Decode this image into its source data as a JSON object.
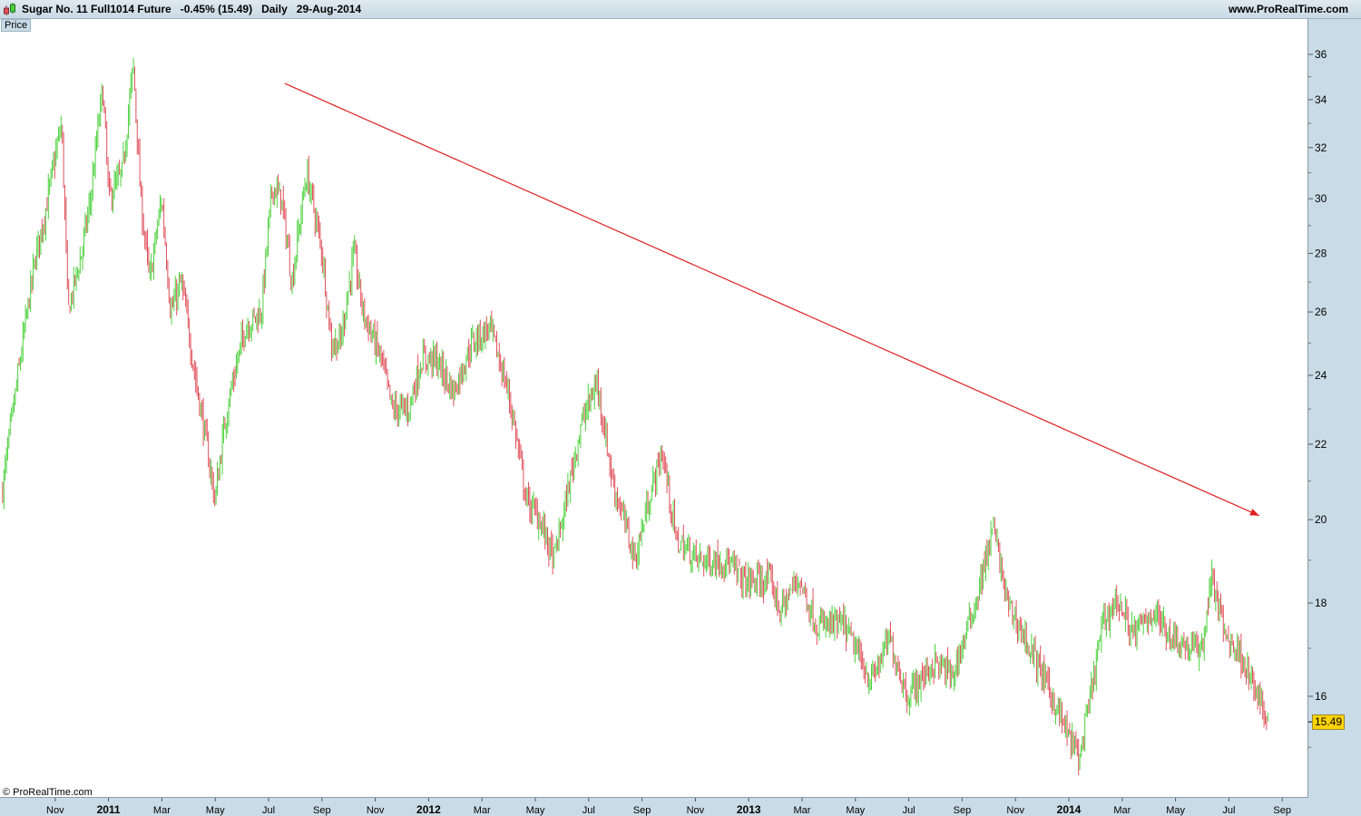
{
  "header": {
    "title": "Sugar No. 11 Full1014 Future   -0.45% (15.49)   Daily   29-Aug-2014",
    "site": "www.ProRealTime.com"
  },
  "panel_label": "Price",
  "copyright": "© ProRealTime.com",
  "colors": {
    "up": "#4cd13c",
    "down": "#e0505a",
    "trend": "#e02020",
    "last_bg": "#ffd200"
  },
  "chart_data": {
    "type": "ohlc",
    "title": "Sugar No. 11 Full1014 Future",
    "scale": "log",
    "ylim": [
      14.3,
      37.2
    ],
    "y_ticks": [
      36,
      34,
      32,
      30,
      28,
      26,
      24,
      22,
      20,
      18,
      16
    ],
    "last_price": "15.49",
    "x_origin": "Sep 2010",
    "x_ticks": [
      {
        "m": 2,
        "label": "Nov",
        "year": false
      },
      {
        "m": 4,
        "label": "2011",
        "year": true
      },
      {
        "m": 6,
        "label": "Mar",
        "year": false
      },
      {
        "m": 8,
        "label": "May",
        "year": false
      },
      {
        "m": 10,
        "label": "Jul",
        "year": false
      },
      {
        "m": 12,
        "label": "Sep",
        "year": false
      },
      {
        "m": 14,
        "label": "Nov",
        "year": false
      },
      {
        "m": 16,
        "label": "2012",
        "year": true
      },
      {
        "m": 18,
        "label": "Mar",
        "year": false
      },
      {
        "m": 20,
        "label": "May",
        "year": false
      },
      {
        "m": 22,
        "label": "Jul",
        "year": false
      },
      {
        "m": 24,
        "label": "Sep",
        "year": false
      },
      {
        "m": 26,
        "label": "Nov",
        "year": false
      },
      {
        "m": 28,
        "label": "2013",
        "year": true
      },
      {
        "m": 30,
        "label": "Mar",
        "year": false
      },
      {
        "m": 32,
        "label": "May",
        "year": false
      },
      {
        "m": 34,
        "label": "Jul",
        "year": false
      },
      {
        "m": 36,
        "label": "Sep",
        "year": false
      },
      {
        "m": 38,
        "label": "Nov",
        "year": false
      },
      {
        "m": 40,
        "label": "2014",
        "year": true
      },
      {
        "m": 42,
        "label": "Mar",
        "year": false
      },
      {
        "m": 44,
        "label": "May",
        "year": false
      },
      {
        "m": 46,
        "label": "Jul",
        "year": false
      },
      {
        "m": 48,
        "label": "Sep",
        "year": false
      }
    ],
    "price_path_months_since_sep2010": [
      [
        0.03,
        20.8
      ],
      [
        0.61,
        24
      ],
      [
        1.29,
        28
      ],
      [
        1.63,
        29.5
      ],
      [
        2.24,
        33
      ],
      [
        2.48,
        26
      ],
      [
        2.99,
        28
      ],
      [
        3.33,
        30
      ],
      [
        3.78,
        34.5
      ],
      [
        4.01,
        30
      ],
      [
        4.52,
        31
      ],
      [
        4.93,
        35.5
      ],
      [
        5.2,
        30
      ],
      [
        5.54,
        27
      ],
      [
        5.99,
        30
      ],
      [
        6.33,
        26
      ],
      [
        6.73,
        27
      ],
      [
        7.24,
        24
      ],
      [
        7.99,
        20.5
      ],
      [
        8.44,
        23
      ],
      [
        9.12,
        25.5
      ],
      [
        9.73,
        26
      ],
      [
        10.14,
        30.5
      ],
      [
        10.48,
        30
      ],
      [
        10.88,
        27
      ],
      [
        11.43,
        31
      ],
      [
        12.01,
        28
      ],
      [
        12.35,
        25
      ],
      [
        12.69,
        25
      ],
      [
        13.2,
        28
      ],
      [
        13.54,
        26
      ],
      [
        14.22,
        24.5
      ],
      [
        14.63,
        23
      ],
      [
        15.24,
        23
      ],
      [
        15.75,
        24.5
      ],
      [
        16.26,
        24.5
      ],
      [
        16.94,
        23.5
      ],
      [
        17.62,
        25
      ],
      [
        18.3,
        25.5
      ],
      [
        18.98,
        23.5
      ],
      [
        19.22,
        22.5
      ],
      [
        19.66,
        20.5
      ],
      [
        20.17,
        20
      ],
      [
        20.68,
        19
      ],
      [
        21.02,
        20
      ],
      [
        21.7,
        22.5
      ],
      [
        22.31,
        23.8
      ],
      [
        22.89,
        21
      ],
      [
        23.74,
        19
      ],
      [
        24.25,
        20.5
      ],
      [
        24.76,
        21.8
      ],
      [
        25.27,
        19.5
      ],
      [
        26.12,
        19
      ],
      [
        27.14,
        19
      ],
      [
        27.82,
        18.5
      ],
      [
        28.84,
        18.5
      ],
      [
        29.18,
        17.8
      ],
      [
        29.86,
        18.6
      ],
      [
        30.54,
        17.5
      ],
      [
        31.56,
        17.5
      ],
      [
        32.59,
        16.3
      ],
      [
        33.27,
        17.2
      ],
      [
        33.95,
        16
      ],
      [
        34.97,
        16.7
      ],
      [
        35.65,
        16.4
      ],
      [
        36.5,
        18
      ],
      [
        37.18,
        19.8
      ],
      [
        37.69,
        18
      ],
      [
        38.54,
        17
      ],
      [
        39.05,
        16.4
      ],
      [
        39.9,
        15.3
      ],
      [
        40.41,
        14.8
      ],
      [
        40.75,
        15.8
      ],
      [
        41.26,
        17.5
      ],
      [
        41.77,
        18.1
      ],
      [
        42.45,
        17.3
      ],
      [
        43.13,
        17.8
      ],
      [
        43.81,
        17.3
      ],
      [
        44.49,
        17.0
      ],
      [
        45.0,
        17.0
      ],
      [
        45.34,
        18.6
      ],
      [
        45.85,
        17.3
      ],
      [
        46.53,
        16.8
      ],
      [
        47.04,
        16.0
      ],
      [
        47.48,
        15.49
      ]
    ],
    "annotations": [
      {
        "type": "arrow",
        "from": [
          10.61,
          34.7
        ],
        "to": [
          47.14,
          20.1
        ],
        "color": "#e02020"
      }
    ]
  }
}
